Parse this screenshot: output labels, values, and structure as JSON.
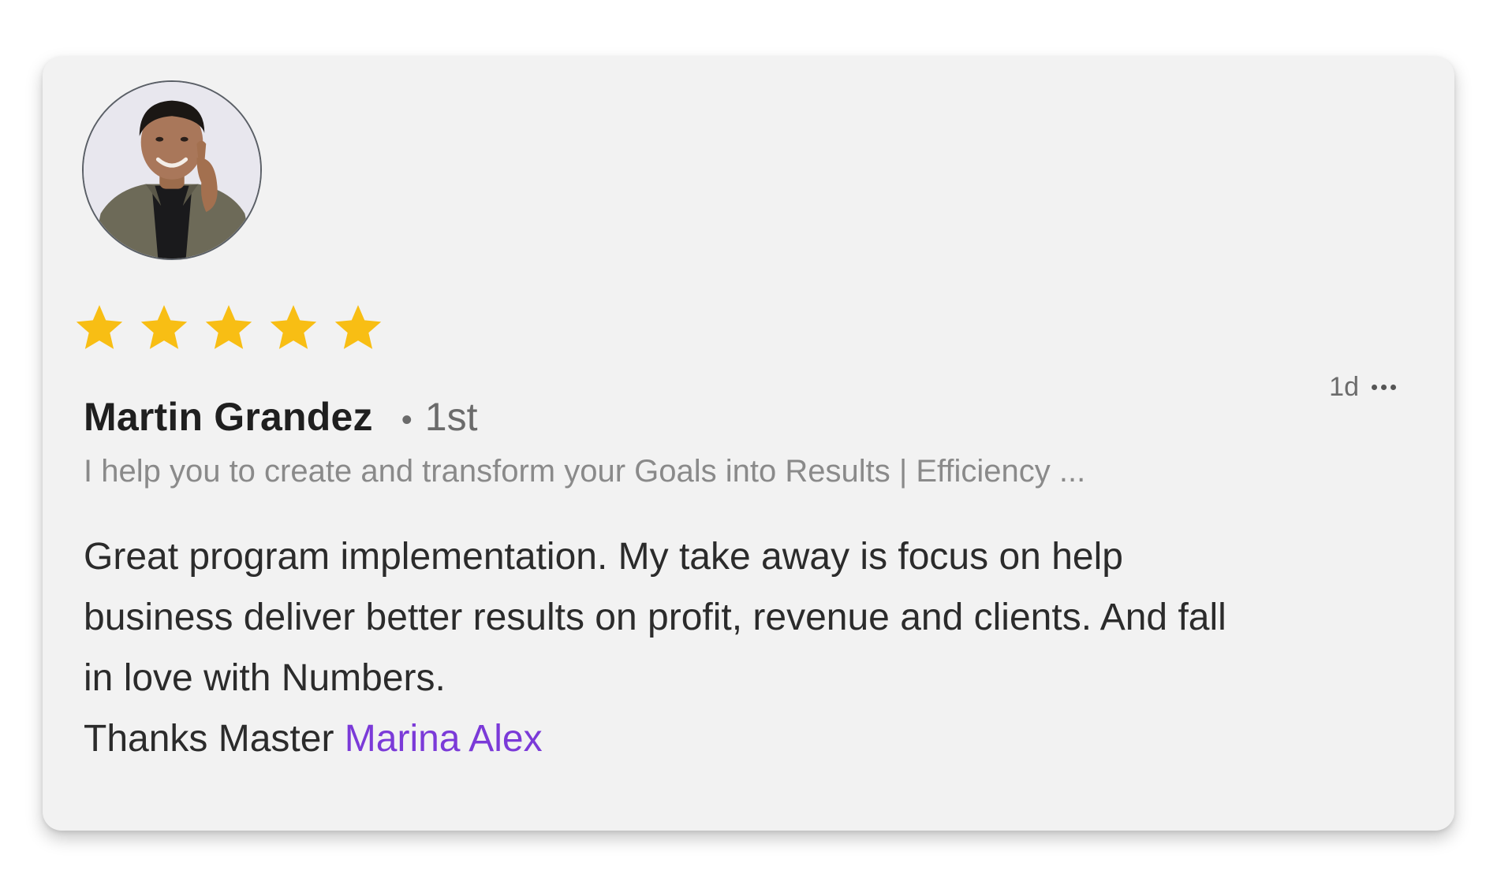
{
  "review": {
    "author_name": "Martin Grandez",
    "connection_separator": "•",
    "connection_degree": "1st",
    "timestamp": "1d",
    "more_icon": "more-horizontal-icon",
    "headline": "I help you to create and transform your Goals into Results | Efficiency ...",
    "rating": 5,
    "rating_max": 5,
    "star_color": "#F8BE14",
    "body_lines": [
      "Great program implementation. My take away is focus on help",
      "business deliver better results on profit, revenue and clients. And fall",
      "in love with Numbers."
    ],
    "thanks_prefix": "Thanks Master ",
    "mention": "Marina Alex",
    "mention_color": "#7B3AD8"
  }
}
